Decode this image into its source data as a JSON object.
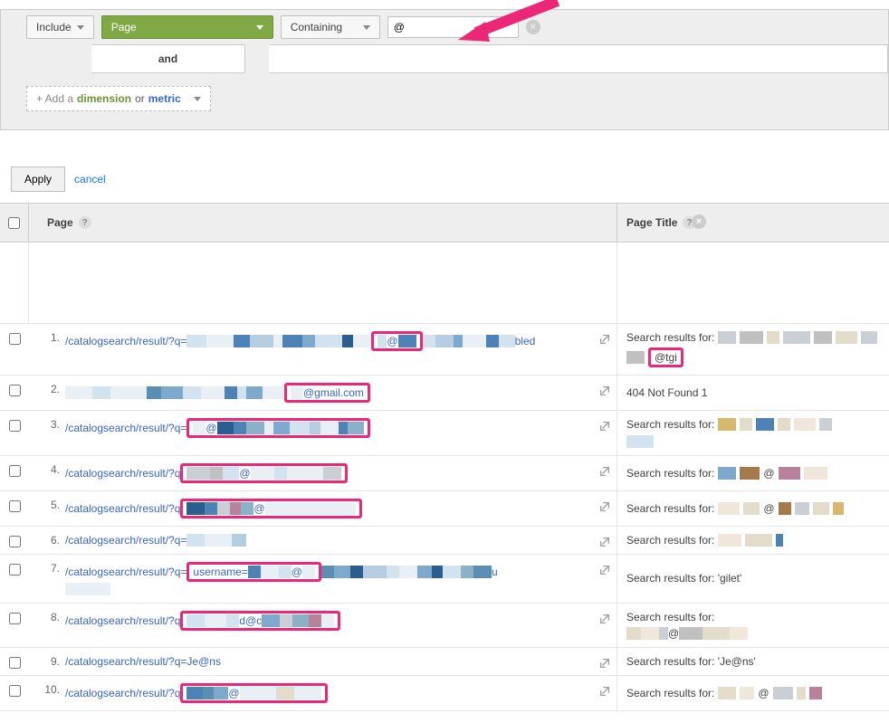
{
  "filter": {
    "include_label": "Include",
    "dimension_label": "Page",
    "match_label": "Containing",
    "value": "@",
    "and_label": "and",
    "add_dimension_prefix": "+ Add a",
    "add_dimension_dim": "dimension",
    "add_dimension_or": "or",
    "add_dimension_metric": "metric",
    "apply_label": "Apply",
    "cancel_label": "cancel"
  },
  "columns": {
    "page": "Page",
    "page_title": "Page Title"
  },
  "rows": [
    {
      "num": "1.",
      "page_prefix": "/catalogsearch/result/?q=",
      "page_suffix": "bled",
      "at_text": "@",
      "title_prefix": "Search results for:",
      "title_highlight": "@tgi"
    },
    {
      "num": "2.",
      "at_text": "@gmail.com",
      "title_prefix": "404 Not Found 1"
    },
    {
      "num": "3.",
      "page_prefix": "/catalogsearch/result/?q=",
      "at_text": "@",
      "title_prefix": "Search results for:"
    },
    {
      "num": "4.",
      "page_prefix": "/catalogsearch/result/?q",
      "at_text": "@",
      "title_prefix": "Search results for:",
      "title_at": "@"
    },
    {
      "num": "5.",
      "page_prefix": "/catalogsearch/result/?q",
      "at_text": "@",
      "title_prefix": "Search results for:",
      "title_at": "@"
    },
    {
      "num": "6.",
      "page_prefix": "/catalogsearch/result/?q=",
      "title_prefix": "Search results for:"
    },
    {
      "num": "7.",
      "page_prefix": "/catalogsearch/result/?q=",
      "at_text_pre": "username=",
      "at_text": "@",
      "page_suffix_end": "u",
      "title_prefix": "Search results for: 'gilet'"
    },
    {
      "num": "8.",
      "page_prefix": "/catalogsearch/result/?q",
      "at_text_mid": "d@c",
      "title_prefix": "Search results for:",
      "title_at": "@"
    },
    {
      "num": "9.",
      "page_prefix": "/catalogsearch/result/?q=Je@ns",
      "title_prefix": "Search results for: 'Je@ns'"
    },
    {
      "num": "10.",
      "page_prefix": "/catalogsearch/result/?q",
      "at_text": "@",
      "title_prefix": "Search results for:",
      "title_at": "@"
    }
  ]
}
